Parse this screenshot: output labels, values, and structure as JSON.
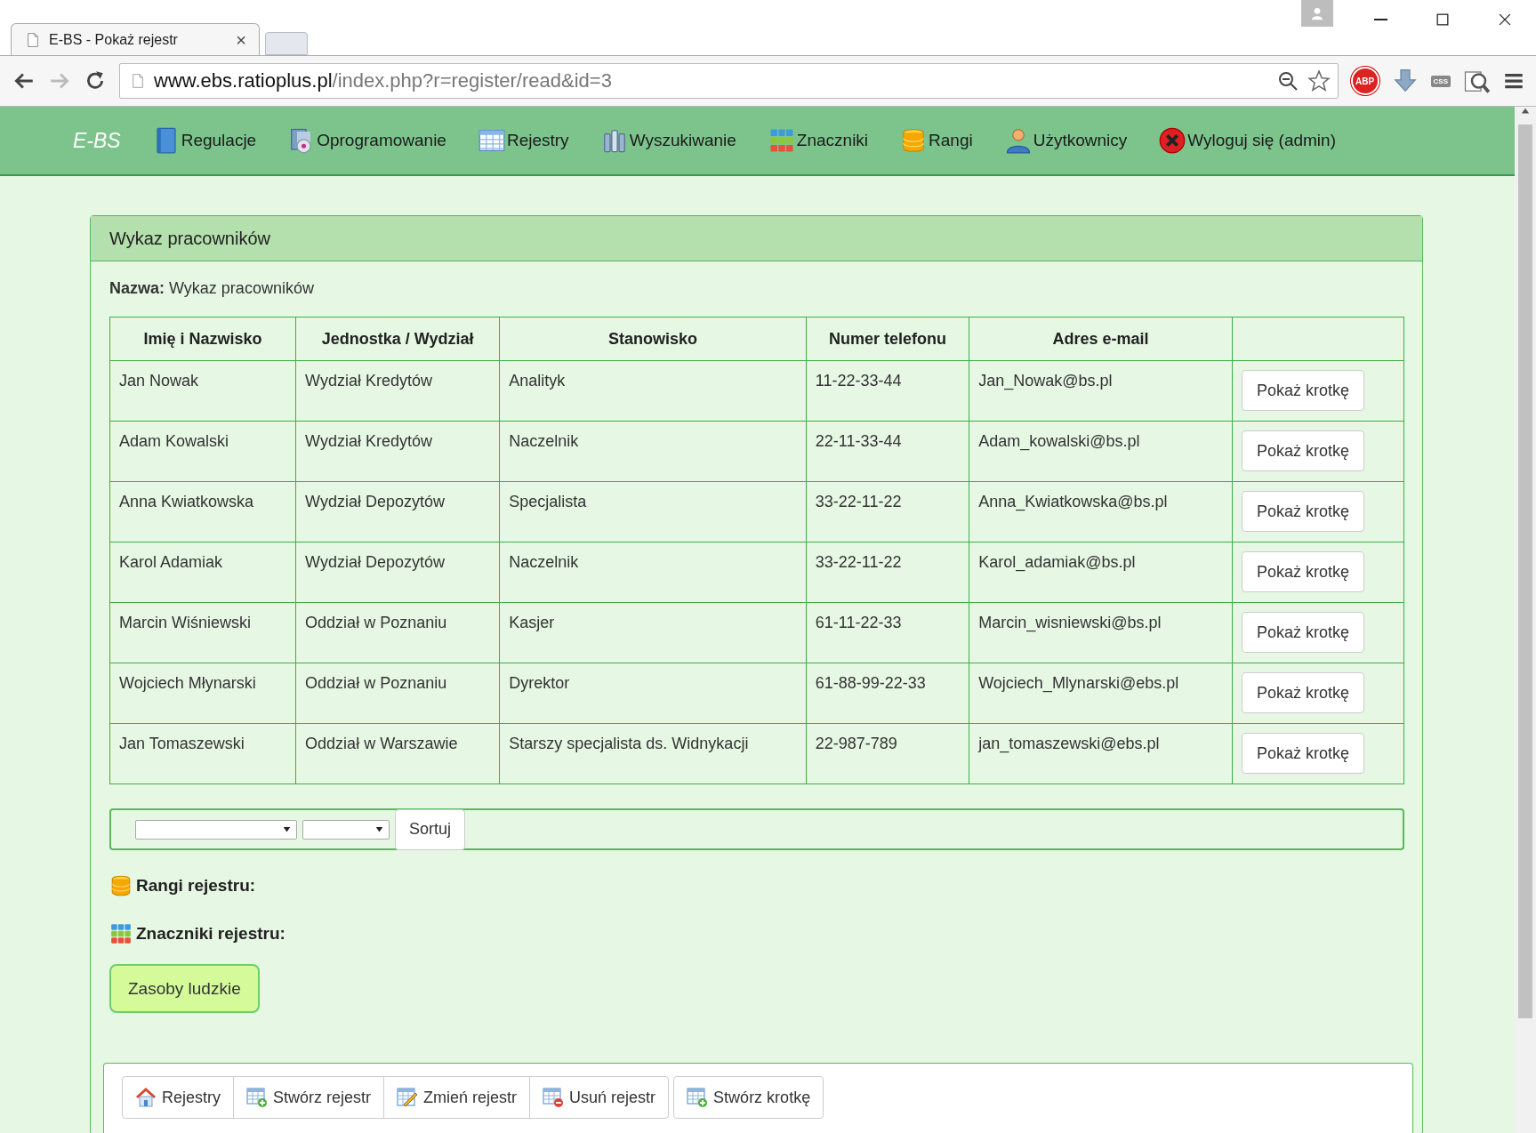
{
  "browser": {
    "tab_title": "E-BS - Pokaż rejestr",
    "tab_close": "×",
    "url_host": "www.ebs.ratioplus.pl",
    "url_path": "/index.php?r=register/read&id=3",
    "abp": "ABP",
    "css": "CSS"
  },
  "nav": {
    "brand": "E-BS",
    "items": [
      {
        "label": "Regulacje"
      },
      {
        "label": "Oprogramowanie"
      },
      {
        "label": "Rejestry"
      },
      {
        "label": "Wyszukiwanie"
      },
      {
        "label": "Znaczniki"
      },
      {
        "label": "Rangi"
      },
      {
        "label": "Użytkownicy"
      },
      {
        "label": "Wyloguj się (admin)"
      }
    ]
  },
  "panel": {
    "title": "Wykaz pracowników",
    "name_label": "Nazwa:",
    "name_value": "Wykaz pracowników"
  },
  "table": {
    "columns": [
      "Imię i Nazwisko",
      "Jednostka / Wydział",
      "Stanowisko",
      "Numer telefonu",
      "Adres e-mail"
    ],
    "rows": [
      {
        "cells": [
          "Jan Nowak",
          "Wydział Kredytów",
          "Analityk",
          "11-22-33-44",
          "Jan_Nowak@bs.pl"
        ],
        "action": "Pokaż krotkę"
      },
      {
        "cells": [
          "Adam Kowalski",
          "Wydział Kredytów",
          "Naczelnik",
          "22-11-33-44",
          "Adam_kowalski@bs.pl"
        ],
        "action": "Pokaż krotkę"
      },
      {
        "cells": [
          "Anna Kwiatkowska",
          "Wydział Depozytów",
          "Specjalista",
          "33-22-11-22",
          "Anna_Kwiatkowska@bs.pl"
        ],
        "action": "Pokaż krotkę"
      },
      {
        "cells": [
          "Karol Adamiak",
          "Wydział Depozytów",
          "Naczelnik",
          "33-22-11-22",
          "Karol_adamiak@bs.pl"
        ],
        "action": "Pokaż krotkę"
      },
      {
        "cells": [
          "Marcin Wiśniewski",
          "Oddział w Poznaniu",
          "Kasjer",
          "61-11-22-33",
          "Marcin_wisniewski@bs.pl"
        ],
        "action": "Pokaż krotkę"
      },
      {
        "cells": [
          "Wojciech Młynarski",
          "Oddział w Poznaniu",
          "Dyrektor",
          "61-88-99-22-33",
          "Wojciech_Mlynarski@ebs.pl"
        ],
        "action": "Pokaż krotkę"
      },
      {
        "cells": [
          "Jan Tomaszewski",
          "Oddział w Warszawie",
          "Starszy specjalista ds. Widnykacji",
          "22-987-789",
          "jan_tomaszewski@ebs.pl"
        ],
        "action": "Pokaż krotkę"
      }
    ]
  },
  "sort": {
    "button": "Sortuj"
  },
  "ranks": {
    "title": "Rangi rejestru:"
  },
  "tags": {
    "title": "Znaczniki rejestru:",
    "items": [
      "Zasoby ludzkie"
    ]
  },
  "toolbar": {
    "main": [
      "Rejestry",
      "Stwórz rejestr",
      "Zmień rejestr",
      "Usuń rejestr"
    ],
    "extra": [
      "Stwórz krotkę"
    ]
  }
}
